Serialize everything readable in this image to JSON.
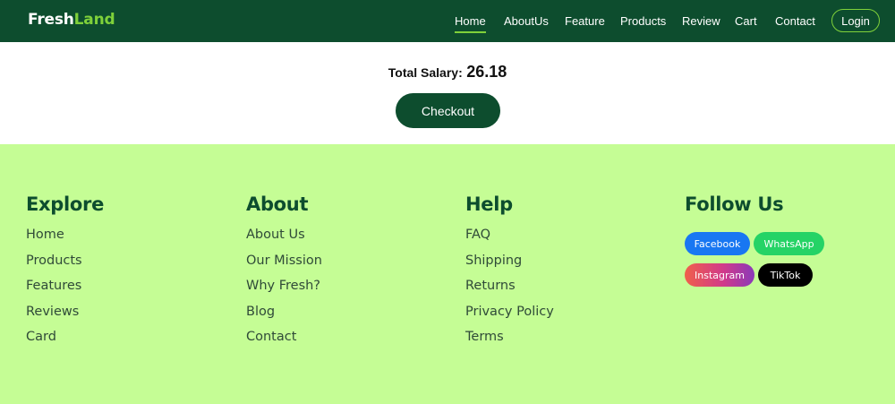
{
  "header": {
    "logo_part1": "Fresh",
    "logo_part2": "Land",
    "nav": [
      "Home",
      "AboutUs",
      "Feature",
      "Products",
      "Review",
      "Cart",
      "Contact"
    ],
    "login_label": "Login"
  },
  "main": {
    "salary_label": "Total Salary:",
    "salary_value": "26.18",
    "checkout_label": "Checkout"
  },
  "footer": {
    "explore": {
      "title": "Explore",
      "items": [
        "Home",
        "Products",
        "Features",
        "Reviews",
        "Card"
      ]
    },
    "about": {
      "title": "About",
      "items": [
        "About Us",
        "Our Mission",
        "Why Fresh?",
        "Blog",
        "Contact"
      ]
    },
    "help": {
      "title": "Help",
      "items": [
        "FAQ",
        "Shipping",
        "Returns",
        "Privacy Policy",
        "Terms"
      ]
    },
    "follow": {
      "title": "Follow Us",
      "facebook": "Facebook",
      "whatsapp": "WhatsApp",
      "instagram": "Instagram",
      "tiktok": "TikTok"
    }
  },
  "colors": {
    "header_bg": "#0d4d2e",
    "accent": "#7fd13a",
    "footer_bg": "#c5fd95"
  }
}
